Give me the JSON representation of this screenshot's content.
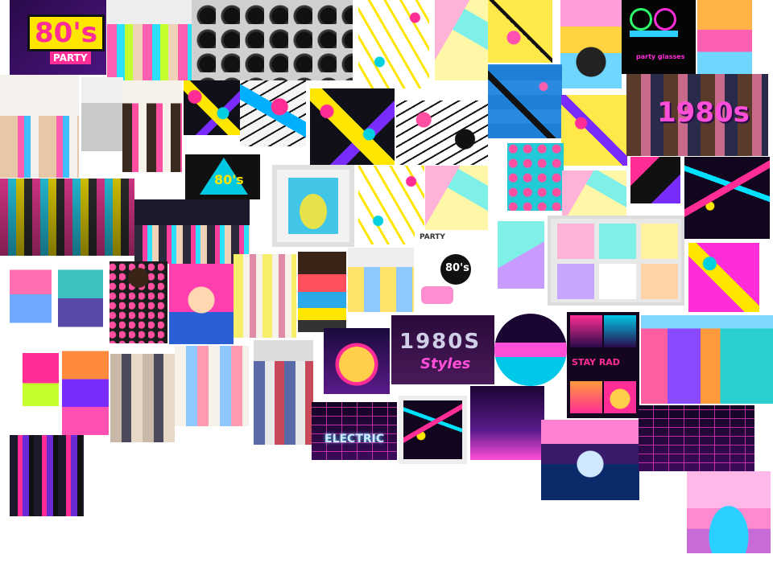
{
  "board": {
    "party_logo_text": "80's",
    "party_logo_sub": "PARTY",
    "banner_80s_text": "80's",
    "title_1980s": "1980s",
    "styles_main": "1980S",
    "styles_script": "Styles",
    "stay_rad": "STAY RAD",
    "electric": "ELECTRIC",
    "glow_caption": "party glasses",
    "party_sign": "PARTY",
    "eighties_badge": "80's"
  },
  "colors": {
    "hot_pink": "#ff2d95",
    "cyan": "#00d0e0",
    "yellow": "#ffe600",
    "purple": "#7a2cff"
  }
}
